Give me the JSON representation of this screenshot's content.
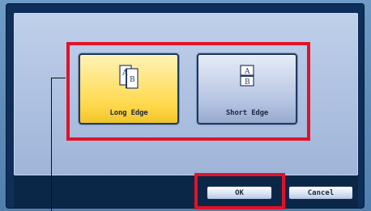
{
  "dialog": {
    "choices": [
      {
        "label": "Long Edge",
        "icon": "long-edge-icon",
        "selected": true
      },
      {
        "label": "Short Edge",
        "icon": "short-edge-icon",
        "selected": false
      }
    ],
    "buttons": {
      "ok_label": "OK",
      "cancel_label": "Cancel"
    }
  },
  "colors": {
    "highlight_red": "#e0122a",
    "selected_yellow": "#ffd84a",
    "panel_navy": "#0d2f59"
  }
}
